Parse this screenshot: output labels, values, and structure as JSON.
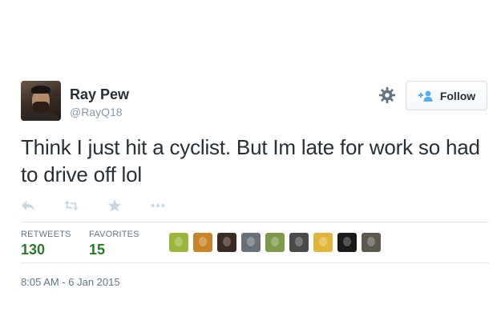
{
  "profile": {
    "display_name": "Ray Pew",
    "handle": "@RayQ18"
  },
  "follow_button": {
    "label": "Follow",
    "icon": "add-user-icon"
  },
  "settings_icon": "gear-icon",
  "tweet": {
    "text": "Think I just hit a cyclist. But Im late for work so had to drive off lol"
  },
  "actions": [
    "reply-icon",
    "retweet-icon",
    "favorite-icon",
    "more-icon"
  ],
  "stats": {
    "retweets_label": "RETWEETS",
    "retweets_count": "130",
    "favorites_label": "FAVORITES",
    "favorites_count": "15"
  },
  "favoriters": [
    {
      "color": "#9ab63c"
    },
    {
      "color": "#c8842a"
    },
    {
      "color": "#3b2a22"
    },
    {
      "color": "#6a6f78"
    },
    {
      "color": "#7f9a4a"
    },
    {
      "color": "#4a4a4a"
    },
    {
      "color": "#e0b63a"
    },
    {
      "color": "#1a1a1a"
    },
    {
      "color": "#5a5850"
    }
  ],
  "timestamp": "8:05 AM - 6 Jan 2015",
  "colors": {
    "text": "#292f33",
    "muted": "#8899a6",
    "stat_value": "#2b7a2b",
    "follow_icon": "#55acee"
  }
}
